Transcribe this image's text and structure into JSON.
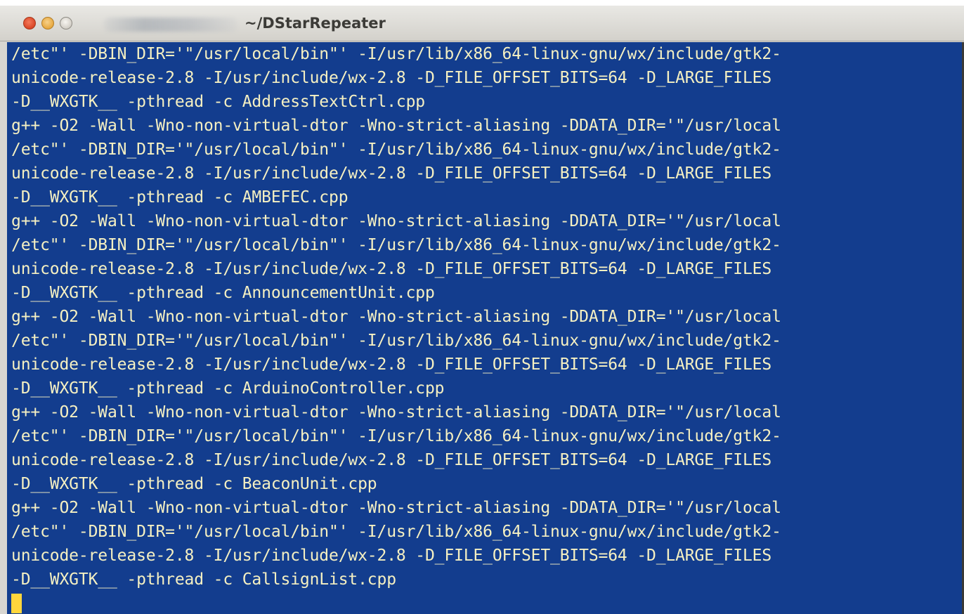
{
  "window": {
    "user_host": "derek@N5ilon",
    "path": "~/DStarRepeater"
  },
  "terminal": {
    "lines": [
      "/etc\"' -DBIN_DIR='\"/usr/local/bin\"' -I/usr/lib/x86_64-linux-gnu/wx/include/gtk2-",
      "unicode-release-2.8 -I/usr/include/wx-2.8 -D_FILE_OFFSET_BITS=64 -D_LARGE_FILES",
      "-D__WXGTK__ -pthread -c AddressTextCtrl.cpp",
      "g++ -O2 -Wall -Wno-non-virtual-dtor -Wno-strict-aliasing -DDATA_DIR='\"/usr/local",
      "/etc\"' -DBIN_DIR='\"/usr/local/bin\"' -I/usr/lib/x86_64-linux-gnu/wx/include/gtk2-",
      "unicode-release-2.8 -I/usr/include/wx-2.8 -D_FILE_OFFSET_BITS=64 -D_LARGE_FILES",
      "-D__WXGTK__ -pthread -c AMBEFEC.cpp",
      "g++ -O2 -Wall -Wno-non-virtual-dtor -Wno-strict-aliasing -DDATA_DIR='\"/usr/local",
      "/etc\"' -DBIN_DIR='\"/usr/local/bin\"' -I/usr/lib/x86_64-linux-gnu/wx/include/gtk2-",
      "unicode-release-2.8 -I/usr/include/wx-2.8 -D_FILE_OFFSET_BITS=64 -D_LARGE_FILES",
      "-D__WXGTK__ -pthread -c AnnouncementUnit.cpp",
      "g++ -O2 -Wall -Wno-non-virtual-dtor -Wno-strict-aliasing -DDATA_DIR='\"/usr/local",
      "/etc\"' -DBIN_DIR='\"/usr/local/bin\"' -I/usr/lib/x86_64-linux-gnu/wx/include/gtk2-",
      "unicode-release-2.8 -I/usr/include/wx-2.8 -D_FILE_OFFSET_BITS=64 -D_LARGE_FILES",
      "-D__WXGTK__ -pthread -c ArduinoController.cpp",
      "g++ -O2 -Wall -Wno-non-virtual-dtor -Wno-strict-aliasing -DDATA_DIR='\"/usr/local",
      "/etc\"' -DBIN_DIR='\"/usr/local/bin\"' -I/usr/lib/x86_64-linux-gnu/wx/include/gtk2-",
      "unicode-release-2.8 -I/usr/include/wx-2.8 -D_FILE_OFFSET_BITS=64 -D_LARGE_FILES",
      "-D__WXGTK__ -pthread -c BeaconUnit.cpp",
      "g++ -O2 -Wall -Wno-non-virtual-dtor -Wno-strict-aliasing -DDATA_DIR='\"/usr/local",
      "/etc\"' -DBIN_DIR='\"/usr/local/bin\"' -I/usr/lib/x86_64-linux-gnu/wx/include/gtk2-",
      "unicode-release-2.8 -I/usr/include/wx-2.8 -D_FILE_OFFSET_BITS=64 -D_LARGE_FILES",
      "-D__WXGTK__ -pthread -c CallsignList.cpp"
    ]
  },
  "colors": {
    "terminal_bg": "#133d8e",
    "terminal_fg": "#f5f0c2",
    "cursor": "#ffd63c"
  }
}
